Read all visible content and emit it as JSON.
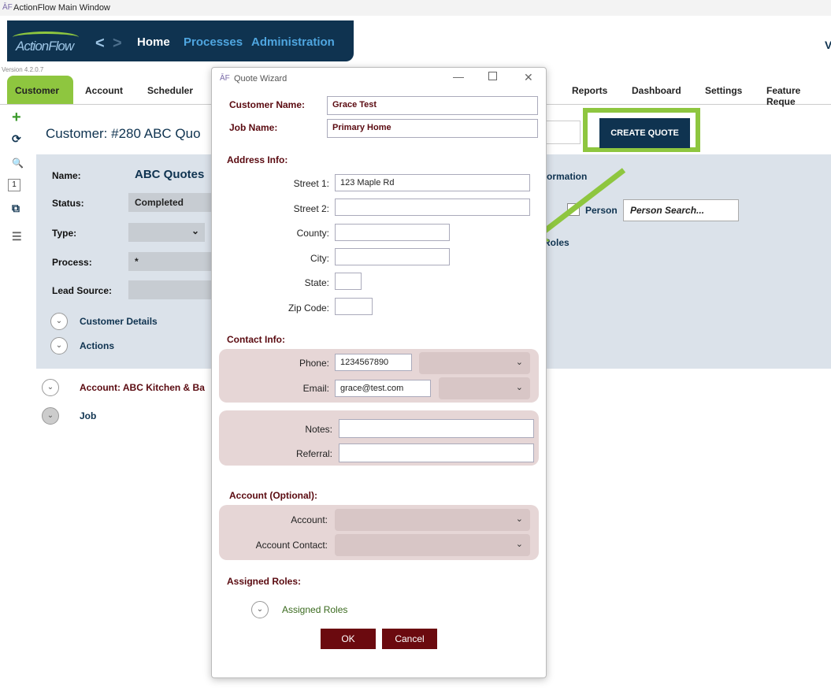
{
  "window": {
    "title": "ActionFlow Main Window",
    "icon": "actionflow-icon"
  },
  "nav": {
    "logo": "ActionFlow",
    "back": "<",
    "forward": ">",
    "links": [
      "Home",
      "Processes",
      "Administration"
    ],
    "version": "Version 4.2.0.7",
    "right_text": "V"
  },
  "tabs": [
    "Customer",
    "Account",
    "Scheduler",
    "Reports",
    "Dashboard",
    "Settings",
    "Feature Reque"
  ],
  "rail": {
    "add": "+",
    "refresh": "⟳",
    "search": "🔍",
    "count": "1",
    "copy": "⧉",
    "list": "☰"
  },
  "customer": {
    "title": "Customer: #280  ABC Quo",
    "fields": [
      {
        "label": "Name:",
        "value": "ABC Quotes"
      },
      {
        "label": "Status:",
        "value": "Completed"
      },
      {
        "label": "Type:",
        "value": ""
      },
      {
        "label": "Process:",
        "value": "*"
      },
      {
        "label": "Lead Source:",
        "value": ""
      }
    ],
    "customer_details": "Customer Details",
    "actions": "Actions",
    "account": "Account: ABC Kitchen & Ba",
    "job": "Job"
  },
  "right": {
    "create_quote": "CREATE QUOTE",
    "information": "formation",
    "person": "Person",
    "person_search": "Person Search...",
    "roles": "Roles"
  },
  "dialog": {
    "title": "Quote Wizard",
    "customer_name_label": "Customer Name:",
    "customer_name": "Grace Test",
    "job_name_label": "Job Name:",
    "job_name": "Primary Home",
    "address_heading": "Address Info:",
    "street1_label": "Street 1:",
    "street1": "123 Maple Rd",
    "street2_label": "Street 2:",
    "street2": "",
    "county_label": "County:",
    "county": "",
    "city_label": "City:",
    "city": "",
    "state_label": "State:",
    "state": "",
    "zip_label": "Zip Code:",
    "zip": "",
    "contact_heading": "Contact Info:",
    "phone_label": "Phone:",
    "phone": "1234567890",
    "email_label": "Email:",
    "email": "grace@test.com",
    "notes_label": "Notes:",
    "notes": "",
    "referral_label": "Referral:",
    "referral": "",
    "account_heading": "Account (Optional):",
    "account_label": "Account:",
    "account_contact_label": "Account Contact:",
    "roles_heading": "Assigned Roles:",
    "roles_link": "Assigned Roles",
    "ok": "OK",
    "cancel": "Cancel"
  },
  "colors": {
    "nav": "#0f3350",
    "accent": "#8ec63f",
    "dialog_label": "#5a0a10",
    "button": "#6b0a0f"
  }
}
